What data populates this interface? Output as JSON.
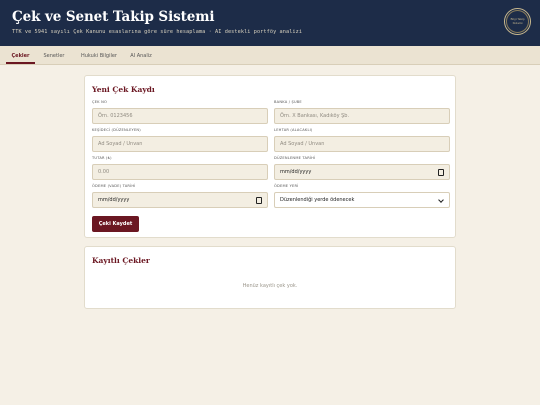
{
  "header": {
    "title": "Çek ve Senet Takip Sistemi",
    "subtitle": "TTK ve 5941 sayılı Çek Kanunu esaslarına göre süre hesaplama · AI destekli portföy analizi",
    "seal_text": "Bilgi Takip Sistemi"
  },
  "tabs": [
    {
      "label": "Çekler",
      "active": true
    },
    {
      "label": "Senetler",
      "active": false
    },
    {
      "label": "Hukuki Bilgiler",
      "active": false
    },
    {
      "label": "AI Analiz",
      "active": false
    }
  ],
  "form": {
    "title": "Yeni Çek Kaydı",
    "fields": {
      "cek_no": {
        "label": "ÇEK NO",
        "placeholder": "Örn. 0123456"
      },
      "banka": {
        "label": "BANKA / ŞUBE",
        "placeholder": "Örn. X Bankası, Kadıköy Şb."
      },
      "kesideci": {
        "label": "KEŞİDECİ (DÜZENLEYEN)",
        "placeholder": "Ad Soyad / Unvan"
      },
      "lehtar": {
        "label": "LEHTAR (ALACAKLI)",
        "placeholder": "Ad Soyad / Unvan"
      },
      "tutar": {
        "label": "TUTAR (₺)",
        "placeholder": "0.00"
      },
      "duzenlenme": {
        "label": "DÜZENLENME TARİHİ",
        "value": "mm/dd/yyyy"
      },
      "odeme_vade": {
        "label": "ÖDEME (VADE) TARİHİ",
        "value": "mm/dd/yyyy"
      },
      "odeme_yeri": {
        "label": "ÖDEME YERİ",
        "value": "Düzenlendiği yerde ödenecek"
      }
    },
    "save_label": "Çeki Kaydet"
  },
  "list": {
    "title": "Kayıtlı Çekler",
    "empty_text": "Henüz kayıtlı çek yok."
  },
  "colors": {
    "header_bg": "#1d2c48",
    "accent": "#6b1722",
    "page_bg": "#f5f0e6"
  }
}
